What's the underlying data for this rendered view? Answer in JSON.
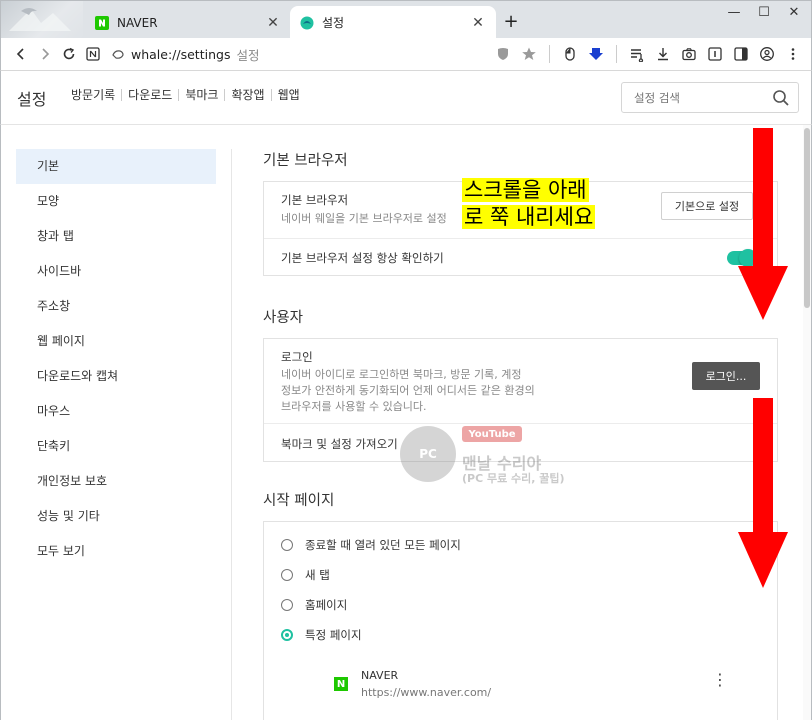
{
  "tabs": [
    {
      "title": "NAVER",
      "favicon": "naver-n-icon"
    },
    {
      "title": "설정",
      "favicon": "whale-icon"
    }
  ],
  "address_bar": {
    "url": "whale://settings",
    "page_title": "설정"
  },
  "settings_header": {
    "title": "설정",
    "nav": [
      "방문기록",
      "다운로드",
      "북마크",
      "확장앱",
      "웹앱"
    ],
    "search_placeholder": "설정 검색"
  },
  "sidebar": {
    "items": [
      "기본",
      "모양",
      "창과 탭",
      "사이드바",
      "주소창",
      "웹 페이지",
      "다운로드와 캡쳐",
      "마우스",
      "단축키",
      "개인정보 보호",
      "성능 및 기타",
      "모두 보기"
    ],
    "active_index": 0
  },
  "sections": {
    "default_browser": {
      "title": "기본 브라우저",
      "label": "기본 브라우저",
      "desc": "네이버 웨일을 기본 브라우저로 설정",
      "button": "기본으로 설정",
      "check_label": "기본 브라우저 설정 항상 확인하기",
      "check_on": true
    },
    "user": {
      "title": "사용자",
      "login_label": "로그인",
      "login_desc_1": "네이버 아이디로 로그인하면 북마크, 방문 기록, 계정",
      "login_desc_2": "정보가 안전하게 동기화되어 언제 어디서든 같은 환경의",
      "login_desc_3": "브라우저를 사용할 수 있습니다.",
      "login_button": "로그인...",
      "import_label": "북마크 및 설정 가져오기"
    },
    "startup": {
      "title": "시작 페이지",
      "options": [
        "종료할 때 열려 있던 모든 페이지",
        "새 탭",
        "홈페이지",
        "특정 페이지"
      ],
      "selected_index": 3,
      "site_name": "NAVER",
      "site_url": "https://www.naver.com/"
    }
  },
  "annotation": {
    "line1": "스크롤을 아래",
    "line2": "로 쭉 내리세요",
    "arrow_color": "#ff0000",
    "highlight_color": "#ffff00"
  },
  "watermark": {
    "badge": "PC",
    "youtube": "YouTube",
    "name": "맨날 수리야",
    "sub": "(PC 무료 수리, 꿀팁)"
  },
  "colors": {
    "accent": "#1fc1a1",
    "sidebar_active": "#e8f1fb"
  }
}
